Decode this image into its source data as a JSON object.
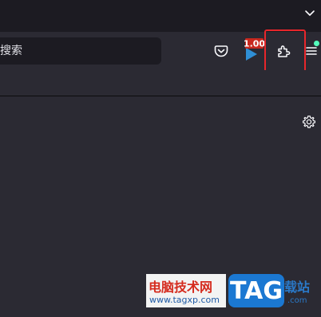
{
  "toolbar": {
    "search_placeholder": "搜索",
    "extension_badge": "1.00",
    "icons": {
      "tab_list": "chevron-down-icon",
      "pocket": "pocket-icon",
      "extension": "extension-badge-icon",
      "extensions_button": "puzzle-icon",
      "app_menu": "hamburger-menu-icon",
      "settings": "gear-icon"
    }
  },
  "highlight": {
    "color": "#e8262b"
  },
  "watermark": {
    "title": "电脑技术网",
    "url": "www.tagxp.com",
    "logo_text": "TAG",
    "side_text": "载站",
    "side_url": ".com"
  },
  "colors": {
    "background": "#2b2a33",
    "tabstrip": "#1c1b22",
    "urlbar": "#1c1b22",
    "update_dot": "#54ffbd"
  }
}
